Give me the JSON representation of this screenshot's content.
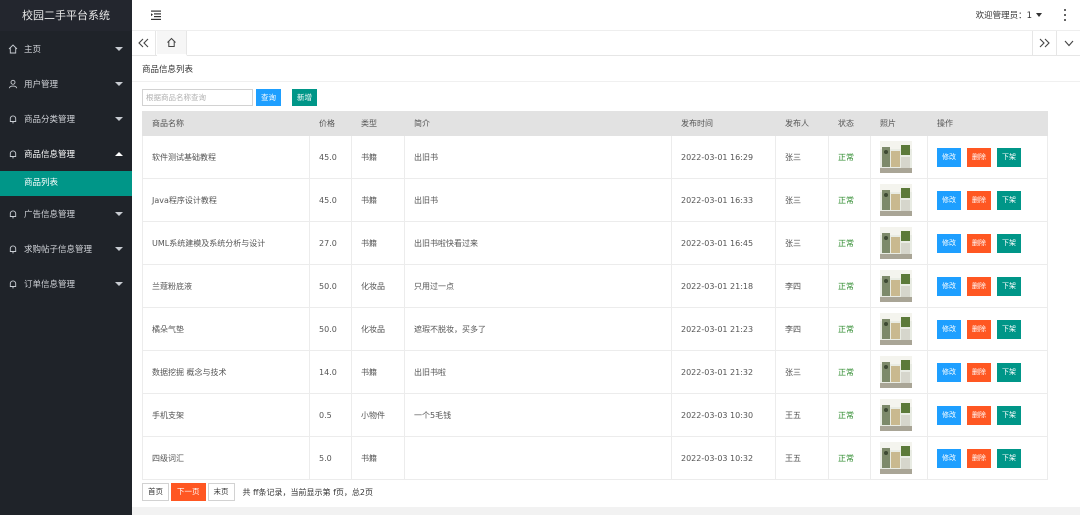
{
  "app": {
    "title": "校园二手平台系统"
  },
  "sidebar": {
    "items": [
      {
        "label": "主页",
        "icon": "home-icon",
        "open": false
      },
      {
        "label": "用户管理",
        "icon": "user-icon",
        "open": false
      },
      {
        "label": "商品分类管理",
        "icon": "bell-icon",
        "open": false
      },
      {
        "label": "商品信息管理",
        "icon": "bell-icon",
        "open": true,
        "children": [
          "商品列表"
        ]
      },
      {
        "label": "广告信息管理",
        "icon": "bell-icon",
        "open": false
      },
      {
        "label": "求购帖子信息管理",
        "icon": "bell-icon",
        "open": false
      },
      {
        "label": "订单信息管理",
        "icon": "bell-icon",
        "open": false
      }
    ]
  },
  "header": {
    "user_label": "欢迎管理员：1"
  },
  "main": {
    "panel_title": "商品信息列表",
    "search_placeholder": "根据商品名称查询",
    "query_label": "查询",
    "add_label": "新增",
    "columns": [
      "商品名称",
      "价格",
      "类型",
      "简介",
      "发布时间",
      "发布人",
      "状态",
      "照片",
      "操作"
    ],
    "rows": [
      {
        "name": "软件测试基础教程",
        "price": "45.0",
        "type": "书籍",
        "desc": "出旧书",
        "time": "2022-03-01 16:29",
        "publisher": "张三",
        "status": "正常"
      },
      {
        "name": "Java程序设计教程",
        "price": "45.0",
        "type": "书籍",
        "desc": "出旧书",
        "time": "2022-03-01 16:33",
        "publisher": "张三",
        "status": "正常"
      },
      {
        "name": "UML系统建模及系统分析与设计",
        "price": "27.0",
        "type": "书籍",
        "desc": "出旧书啦快看过来",
        "time": "2022-03-01 16:45",
        "publisher": "张三",
        "status": "正常"
      },
      {
        "name": "兰蔻粉底液",
        "price": "50.0",
        "type": "化妆品",
        "desc": "只用过一点",
        "time": "2022-03-01 21:18",
        "publisher": "李四",
        "status": "正常"
      },
      {
        "name": "橘朵气垫",
        "price": "50.0",
        "type": "化妆品",
        "desc": "遮瑕不脱妆，买多了",
        "time": "2022-03-01 21:23",
        "publisher": "李四",
        "status": "正常"
      },
      {
        "name": "数据挖掘 概念与技术",
        "price": "14.0",
        "type": "书籍",
        "desc": "出旧书啦",
        "time": "2022-03-01 21:32",
        "publisher": "张三",
        "status": "正常"
      },
      {
        "name": "手机支架",
        "price": "0.5",
        "type": "小物件",
        "desc": "一个5毛钱",
        "time": "2022-03-03 10:30",
        "publisher": "王五",
        "status": "正常"
      },
      {
        "name": "四级词汇",
        "price": "5.0",
        "type": "书籍",
        "desc": "",
        "time": "2022-03-03 10:32",
        "publisher": "王五",
        "status": "正常"
      }
    ],
    "row_actions": {
      "edit": "修改",
      "delete": "删除",
      "offline": "下架"
    },
    "pager": {
      "first": "首页",
      "next": "下一页",
      "last": "末页",
      "info": "共 ff条记录，当前显示第 f页，总2页"
    }
  },
  "colors": {
    "sidebar_bg": "#1f2329",
    "accent": "#009688",
    "primary": "#1e9fff",
    "danger": "#ff5722"
  }
}
